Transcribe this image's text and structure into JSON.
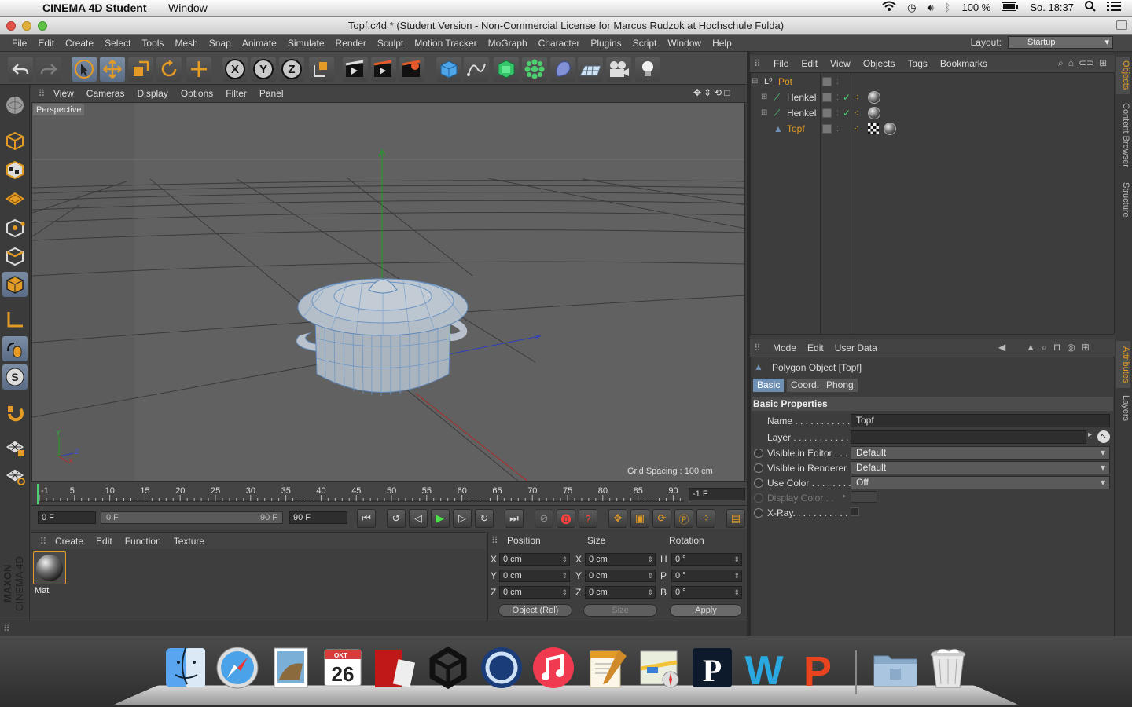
{
  "mac_menubar": {
    "app_name": "CINEMA 4D Student",
    "window_menu": "Window",
    "battery": "100 %",
    "clock": "So. 18:37"
  },
  "window": {
    "title": "Topf.c4d * (Student Version - Non-Commercial License for Marcus Rudzok at Hochschule Fulda)"
  },
  "app_menu": [
    "File",
    "Edit",
    "Create",
    "Select",
    "Tools",
    "Mesh",
    "Snap",
    "Animate",
    "Simulate",
    "Render",
    "Sculpt",
    "Motion Tracker",
    "MoGraph",
    "Character",
    "Plugins",
    "Script",
    "Window",
    "Help"
  ],
  "layout": {
    "label": "Layout:",
    "value": "Startup"
  },
  "viewport": {
    "menu": [
      "View",
      "Cameras",
      "Display",
      "Options",
      "Filter",
      "Panel"
    ],
    "camera_label": "Perspective",
    "grid_spacing": "Grid Spacing : 100 cm",
    "axis_labels": {
      "y": "Y",
      "z": "Z",
      "x": "X"
    }
  },
  "timeline": {
    "ticks": [
      "-1",
      "5",
      "10",
      "15",
      "20",
      "25",
      "30",
      "35",
      "40",
      "45",
      "50",
      "55",
      "60",
      "65",
      "70",
      "75",
      "80",
      "85",
      "90"
    ],
    "current_frame": "-1 F",
    "start_field": "0 F",
    "range_start": "0 F",
    "range_end": "90 F",
    "end_field": "90 F"
  },
  "material_manager": {
    "menu": [
      "Create",
      "Edit",
      "Function",
      "Texture"
    ],
    "materials": [
      {
        "name": "Mat"
      }
    ],
    "logo_line1": "MAXON",
    "logo_line2": "CINEMA 4D"
  },
  "coordinates": {
    "headers": {
      "position": "Position",
      "size": "Size",
      "rotation": "Rotation"
    },
    "rows": [
      {
        "axis": "X",
        "pos": "0 cm",
        "size_axis": "X",
        "size": "0 cm",
        "rot_axis": "H",
        "rot": "0 °"
      },
      {
        "axis": "Y",
        "pos": "0 cm",
        "size_axis": "Y",
        "size": "0 cm",
        "rot_axis": "P",
        "rot": "0 °"
      },
      {
        "axis": "Z",
        "pos": "0 cm",
        "size_axis": "Z",
        "size": "0 cm",
        "rot_axis": "B",
        "rot": "0 °"
      }
    ],
    "mode_dropdown": "Object (Rel)",
    "size_dropdown": "Size",
    "apply_label": "Apply"
  },
  "object_manager": {
    "menu": [
      "File",
      "Edit",
      "View",
      "Objects",
      "Tags",
      "Bookmarks"
    ],
    "objects": [
      {
        "name": "Pot",
        "color": "#e39b25"
      },
      {
        "name": "Henkel",
        "color": "#dddddd"
      },
      {
        "name": "Henkel",
        "color": "#dddddd"
      },
      {
        "name": "Topf",
        "color": "#e39b25"
      }
    ],
    "side_tabs": [
      "Objects",
      "Content Browser",
      "Structure"
    ]
  },
  "attribute_manager": {
    "menu": [
      "Mode",
      "Edit",
      "User Data"
    ],
    "object_title": "Polygon Object [Topf]",
    "tabs": [
      "Basic",
      "Coord.",
      "Phong"
    ],
    "section": "Basic Properties",
    "props": {
      "name_label": "Name . . . . . . . . . . . . .",
      "name_value": "Topf",
      "layer_label": "Layer . . . . . . . . . . . . .",
      "vis_editor_label": "Visible in Editor . . .",
      "vis_editor_value": "Default",
      "vis_render_label": "Visible in Renderer",
      "vis_render_value": "Default",
      "use_color_label": "Use Color . . . . . . . . .",
      "use_color_value": "Off",
      "display_color_label": "Display Color . .",
      "xray_label": "X-Ray. . . . . . . . . . . ."
    },
    "side_tabs": [
      "Attributes",
      "Layers"
    ]
  },
  "dock": {
    "calendar_month": "OKT",
    "calendar_day": "26",
    "items": [
      "finder-icon",
      "safari-icon",
      "preview-icon",
      "calendar-icon",
      "photo-booth-icon",
      "unity-icon",
      "cinema4d-icon",
      "itunes-icon",
      "pages-icon",
      "maps-icon",
      "p-app-icon",
      "w-app-icon",
      "p-red-app-icon",
      "folder-icon",
      "trash-icon"
    ]
  },
  "colors": {
    "accent": "#e39b25",
    "selection": "#6d8fb4",
    "panel": "#3d3d3d"
  }
}
